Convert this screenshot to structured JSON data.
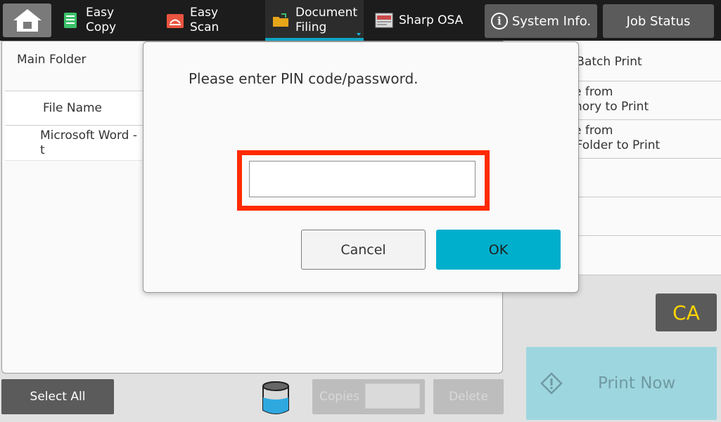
{
  "topbar": {
    "tabs": [
      {
        "label_line1": "Easy",
        "label_line2": "Copy",
        "icon": "easy-copy-icon"
      },
      {
        "label_line1": "Easy",
        "label_line2": "Scan",
        "icon": "easy-scan-icon"
      },
      {
        "label_line1": "Document",
        "label_line2": "Filing",
        "icon": "document-filing-icon"
      },
      {
        "label": "Sharp OSA",
        "icon": "sharp-osa-icon"
      }
    ],
    "active_tab": "Document Filing",
    "system_info_label": "System Info.",
    "job_status_label": "Job Status"
  },
  "file_panel": {
    "folder_name": "Main Folder",
    "column_header": "File Name",
    "rows": [
      {
        "name": "Microsoft Word - t"
      }
    ]
  },
  "right_menu": {
    "items": [
      {
        "label": "ute Batch Print"
      },
      {
        "label": "t File from\nMemory to Print"
      },
      {
        "label": "t File from\nork Folder to Print"
      },
      {
        "label": ""
      },
      {
        "label": ""
      },
      {
        "label": ""
      }
    ]
  },
  "bottom": {
    "select_all_label": "Select All",
    "copies_label": "Copies",
    "delete_label": "Delete",
    "ca_label": "CA",
    "print_now_label": "Print Now"
  },
  "dialog": {
    "message": "Please enter PIN code/password.",
    "pin_value": "",
    "cancel_label": "Cancel",
    "ok_label": "OK"
  },
  "colors": {
    "accent": "#00afcb",
    "highlight_outline": "#ff2a00",
    "ca_text": "#ffd400",
    "topbar_bg": "#1c1c1c"
  }
}
